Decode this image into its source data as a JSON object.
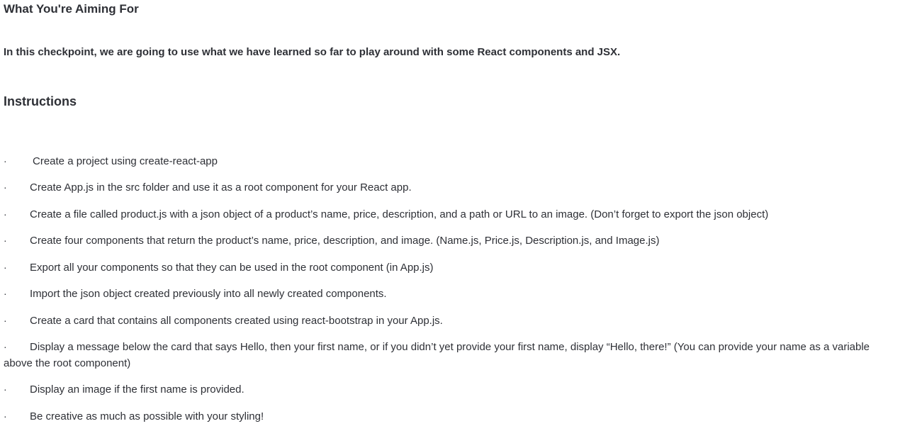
{
  "heading": "What You're Aiming For",
  "intro": "In this checkpoint, we are going to use what we have learned so far to play around with some React components and JSX.",
  "instructions_heading": "Instructions",
  "bullet_char": "·",
  "instructions": [
    "Create a project using create-react-app",
    "Create App.js in the src folder and use it as a root component for your React app.",
    "Create a file called product.js with a json object of a product’s name, price, description, and a path or URL to an image. (Don’t forget to export the json object)",
    "Create four components that return the product’s name, price, description, and image. (Name.js, Price.js, Description.js, and Image.js)",
    "Export all your components so that they can be used in the root component (in App.js)",
    "Import the json object created previously into all newly created components.",
    "Create a card that contains all components created using react-bootstrap in your App.js.",
    "Display a message below the card that says Hello, then your first name, or if you didn’t yet provide your first name, display “Hello, there!” (You can provide your name as a variable above the root component)",
    "Display an image if the first name is provided.",
    "Be creative as much as possible with your styling!"
  ]
}
